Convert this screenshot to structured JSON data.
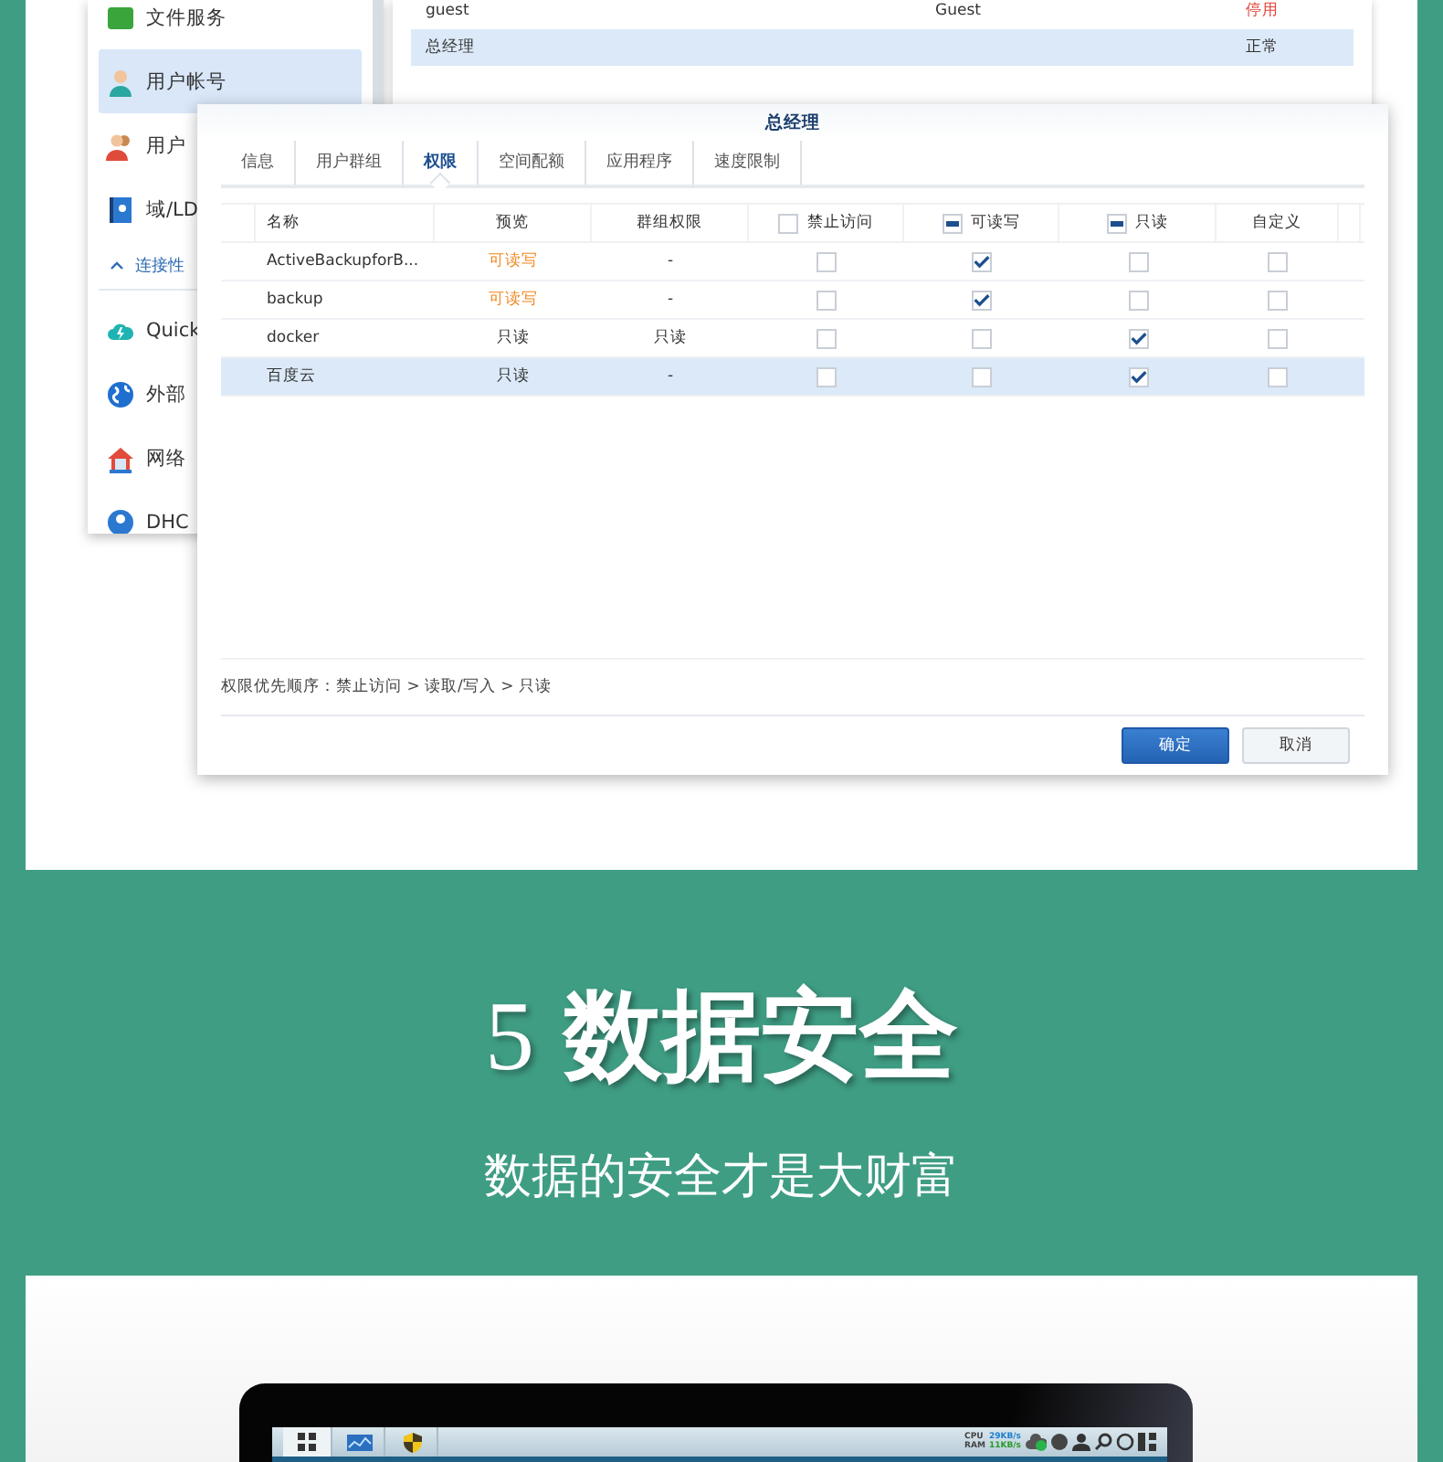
{
  "sidebar": {
    "items": [
      {
        "kind": "item",
        "label": "文件服务",
        "selected": false
      },
      {
        "kind": "item",
        "label": "用户帐号",
        "selected": true
      },
      {
        "kind": "item",
        "label": "用户",
        "selected": false
      },
      {
        "kind": "item",
        "label": "域/LD",
        "selected": false
      },
      {
        "kind": "section",
        "label": "连接性",
        "expanded": true
      },
      {
        "kind": "item",
        "label": "Quick",
        "selected": false
      },
      {
        "kind": "item",
        "label": "外部",
        "selected": false
      },
      {
        "kind": "item",
        "label": "网络",
        "selected": false
      },
      {
        "kind": "item",
        "label": "DHC",
        "selected": false
      }
    ]
  },
  "user_list": {
    "rows": [
      {
        "name": "guest",
        "description": "Guest",
        "status": {
          "text": "停用",
          "color": "#e0463c"
        },
        "selected": false
      },
      {
        "name": "总经理",
        "description": "",
        "status": {
          "text": "正常",
          "color": "#333333"
        },
        "selected": true
      }
    ]
  },
  "dialog": {
    "title": "总经理",
    "tabs": [
      {
        "label": "信息",
        "selected": false
      },
      {
        "label": "用户群组",
        "selected": false
      },
      {
        "label": "权限",
        "selected": true
      },
      {
        "label": "空间配额",
        "selected": false
      },
      {
        "label": "应用程序",
        "selected": false
      },
      {
        "label": "速度限制",
        "selected": false
      }
    ],
    "columns": [
      {
        "label": "名称",
        "kind": "plain"
      },
      {
        "label": "预览",
        "kind": "plain"
      },
      {
        "label": "群组权限",
        "kind": "plain"
      },
      {
        "label": "禁止访问",
        "kind": "checkbox",
        "mixed": false
      },
      {
        "label": "可读写",
        "kind": "checkbox",
        "mixed": true
      },
      {
        "label": "只读",
        "kind": "checkbox",
        "mixed": true
      },
      {
        "label": "自定义",
        "kind": "plain"
      }
    ],
    "rows": [
      {
        "name": "ActiveBackupforB...",
        "preview": {
          "text": "可读写",
          "color": "#f08a24"
        },
        "group": "-",
        "permissions": [
          {
            "checked": false
          },
          {
            "checked": true
          },
          {
            "checked": false
          },
          {
            "checked": false
          }
        ],
        "selected": false
      },
      {
        "name": "backup",
        "preview": {
          "text": "可读写",
          "color": "#f08a24"
        },
        "group": "-",
        "permissions": [
          {
            "checked": false
          },
          {
            "checked": true
          },
          {
            "checked": false
          },
          {
            "checked": false
          }
        ],
        "selected": false
      },
      {
        "name": "docker",
        "preview": {
          "text": "只读",
          "color": "#333333"
        },
        "group": "只读",
        "permissions": [
          {
            "checked": false
          },
          {
            "checked": false
          },
          {
            "checked": true
          },
          {
            "checked": false
          }
        ],
        "selected": false
      },
      {
        "name": "百度云",
        "preview": {
          "text": "只读",
          "color": "#333333"
        },
        "group": "-",
        "permissions": [
          {
            "checked": false
          },
          {
            "checked": false
          },
          {
            "checked": true
          },
          {
            "checked": false
          }
        ],
        "selected": true
      }
    ],
    "footer_note": "权限优先顺序：禁止访问 > 读取/写入 > 只读",
    "buttons": [
      {
        "label": "确定",
        "kind": "primary"
      },
      {
        "label": "取消",
        "kind": "secondary"
      }
    ]
  },
  "feature": {
    "number": "5",
    "title": "数据安全",
    "subtitle": "数据的安全才是大财富"
  },
  "taskbar": {
    "cpu_label": "CPU",
    "ram_label": "RAM",
    "upload": "29KB/s",
    "download": "11KB/s"
  }
}
